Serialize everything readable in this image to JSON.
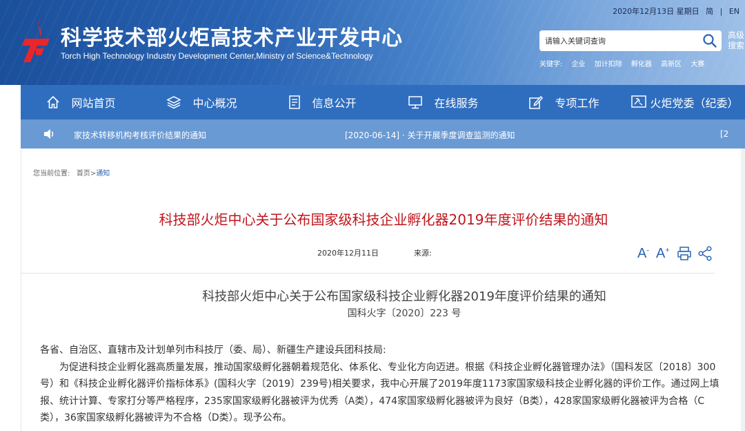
{
  "header": {
    "title": "科学技术部火炬高技术产业开发中心",
    "subtitle": "Torch High Technology Industry Development Center,Ministry of Science&Technology",
    "date": "2020年12月13日 星期日",
    "lang_simplified": "简",
    "lang_sep": "|",
    "lang_en": "EN",
    "search_placeholder": "请输入关键词查询",
    "advanced_search": "高级搜索",
    "keywords_label": "关键字:",
    "keywords": [
      "企业",
      "加计扣除",
      "孵化器",
      "高新区",
      "大赛"
    ]
  },
  "nav": {
    "items": [
      {
        "label": "网站首页",
        "icon": "home-icon"
      },
      {
        "label": "中心概况",
        "icon": "layers-icon"
      },
      {
        "label": "信息公开",
        "icon": "document-icon"
      },
      {
        "label": "在线服务",
        "icon": "monitor-icon"
      },
      {
        "label": "专项工作",
        "icon": "edit-icon"
      },
      {
        "label": "火炬党委（纪委）",
        "icon": "party-icon"
      }
    ]
  },
  "ticker": {
    "item1": "家技术转移机构考核评价结果的通知",
    "item2": "[2020-06-14] · 关于开展季度调查监测的通知",
    "item3": "[2"
  },
  "breadcrumb": {
    "label": "您当前位置:",
    "home": "首页",
    "sep": ">",
    "current": "通知"
  },
  "article": {
    "title": "科技部火炬中心关于公布国家级科技企业孵化器2019年度评价结果的通知",
    "date": "2020年12月11日",
    "source_label": "来源:",
    "font_large": "A",
    "font_small": "A",
    "doc_title": "科技部火炬中心关于公布国家级科技企业孵化器2019年度评价结果的通知",
    "doc_number": "国科火字〔2020〕223 号",
    "salutation": "各省、自治区、直辖市及计划单列市科技厅（委、局）、新疆生产建设兵团科技局:",
    "paragraph1": "为促进科技企业孵化器高质量发展，推动国家级孵化器朝着规范化、体系化、专业化方向迈进。根据《科技企业孵化器管理办法》（国科发区〔2018〕300号）和《科技企业孵化器评价指标体系》(国科火字〔2019〕239号)相关要求，我中心开展了2019年度1173家国家级科技企业孵化器的评价工作。通过网上填报、统计计算、专家打分等严格程序，235家国家级孵化器被评为优秀（A类），474家国家级孵化器被评为良好（B类），428家国家级孵化器被评为合格（C类），36家国家级孵化器被评为不合格（D类）。现予公布。"
  },
  "colors": {
    "header_blue": "#1a4f9b",
    "nav_blue": "#2f6ebf",
    "ticker_blue": "#6a9ad4",
    "title_red": "#c0141b",
    "link_blue": "#2a64b4"
  }
}
